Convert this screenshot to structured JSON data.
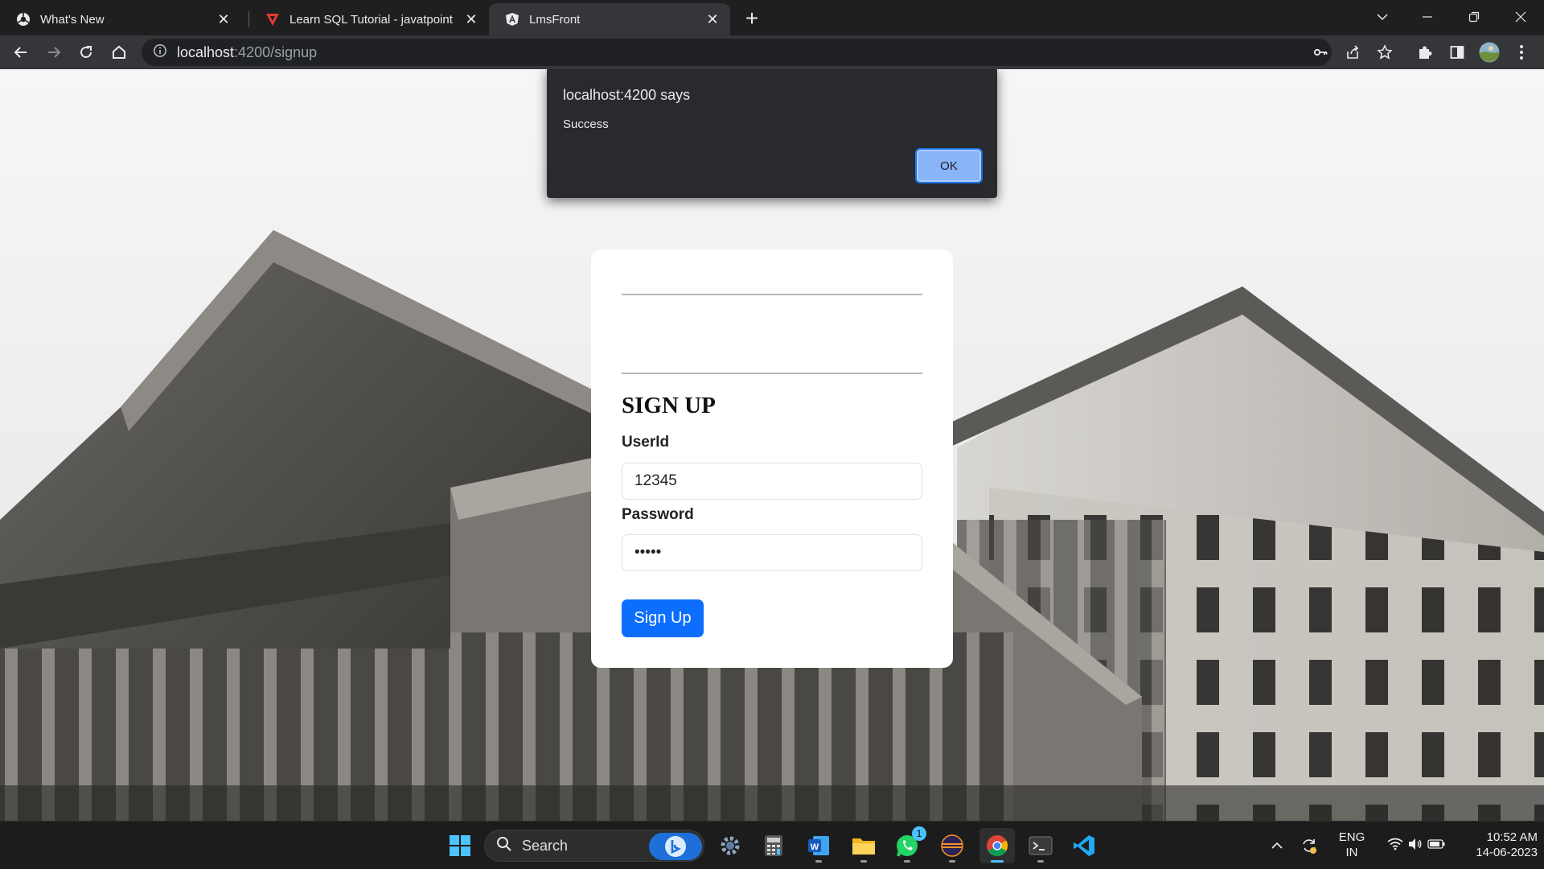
{
  "browser": {
    "tabs": [
      {
        "title": "What's New",
        "icon": "chrome-whats-new-icon",
        "active": false
      },
      {
        "title": "Learn SQL Tutorial - javatpoint",
        "icon": "javatpoint-icon",
        "active": false
      },
      {
        "title": "LmsFront",
        "icon": "angular-icon",
        "active": true
      }
    ],
    "url_host": "localhost",
    "url_rest": ":4200/signup"
  },
  "alert": {
    "title": "localhost:4200 says",
    "message": "Success",
    "ok_label": "OK"
  },
  "form": {
    "title": "SIGN UP",
    "userid_label": "UserId",
    "userid_value": "12345",
    "password_label": "Password",
    "password_value": "•••••",
    "submit_label": "Sign Up",
    "submit_color": "#0d6efd"
  },
  "taskbar": {
    "search_label": "Search",
    "whatsapp_badge": "1",
    "language": "ENG",
    "region": "IN",
    "time": "10:52 AM",
    "date": "14-06-2023"
  }
}
